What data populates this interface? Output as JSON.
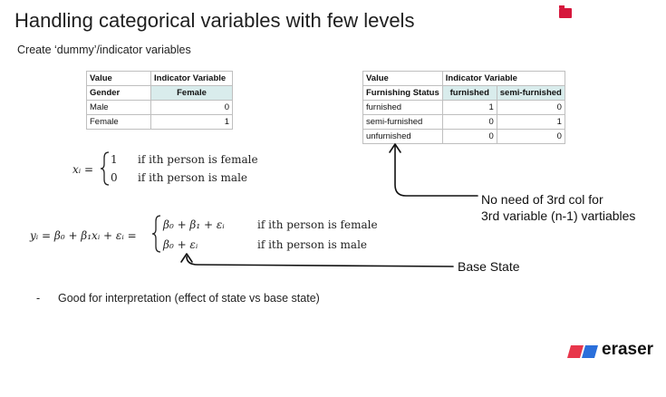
{
  "slide": {
    "title": "Handling categorical variables with few levels",
    "subtitle": "Create ‘dummy’/indicator variables"
  },
  "gender_table": {
    "col1_header": "Value",
    "col2_header": "Indicator Variable",
    "row_header": [
      "Gender",
      "Female"
    ],
    "rows": [
      [
        "Male",
        "0"
      ],
      [
        "Female",
        "1"
      ]
    ]
  },
  "furnishing_table": {
    "col1_header": "Value",
    "col2_header": "Indicator Variable",
    "row_header": [
      "Furnishing Status",
      "furnished",
      "semi-furnished"
    ],
    "rows": [
      [
        "furnished",
        "1",
        "0"
      ],
      [
        "semi-furnished",
        "0",
        "1"
      ],
      [
        "unfurnished",
        "0",
        "0"
      ]
    ]
  },
  "equations": {
    "xi_lhs": "xᵢ =",
    "xi_case1_value": "1",
    "xi_case1_cond": "if ith person is female",
    "xi_case2_value": "0",
    "xi_case2_cond": "if ith person is male",
    "yi_lhs": "yᵢ = β₀ + β₁xᵢ + εᵢ =",
    "yi_case1_value": "β₀ + β₁ + εᵢ",
    "yi_case1_cond": "if ith person is female",
    "yi_case2_value": "β₀ + εᵢ",
    "yi_case2_cond": "if ith person is male"
  },
  "annotations": {
    "col_note_line1": "No need of 3rd col for",
    "col_note_line2": "3rd variable (n-1) vartiables",
    "base_state": "Base State"
  },
  "bullet": {
    "dash": "-",
    "text": "Good for interpretation (effect of state vs base state)"
  },
  "brand": {
    "name": "eraser",
    "colors": [
      "#e8364b",
      "#2a6fdb"
    ]
  },
  "colors": {
    "header_fill": "#d9ecec",
    "badge": "#d6173c"
  }
}
